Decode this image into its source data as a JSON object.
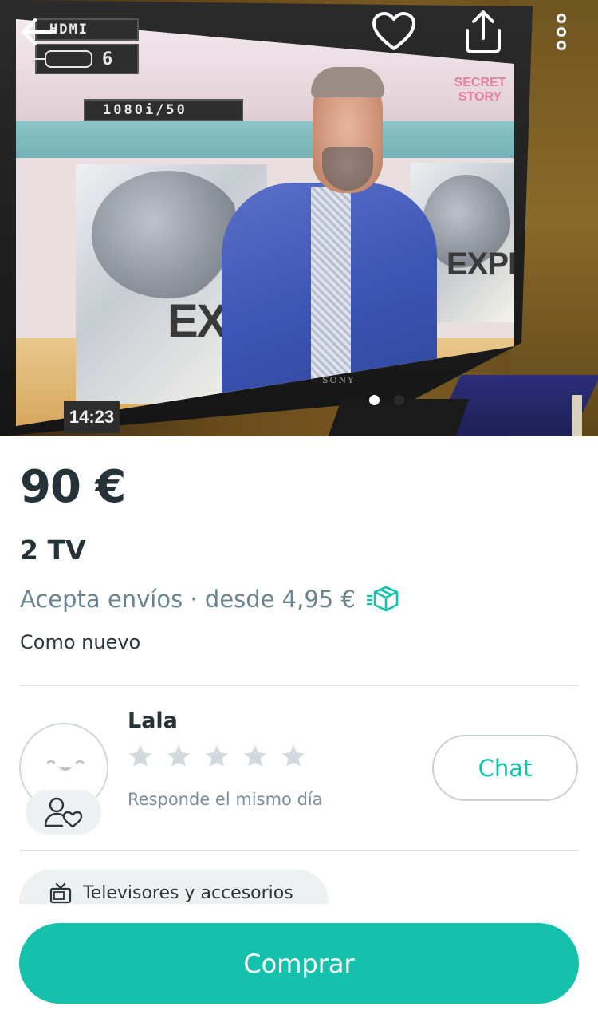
{
  "photo": {
    "osd_input_label": "HDMI",
    "osd_input_number": "6",
    "osd_resolution": "1080i/50",
    "clock": "14:23",
    "brand_on_tv": "SONY",
    "onscreen_left_text": "EX",
    "onscreen_right_text": "EXPR",
    "onscreen_logo": "SECRET STORY",
    "carousel_total": 2,
    "carousel_active": 1
  },
  "toolbar": {
    "back_icon": "arrow-left-icon",
    "favorite_icon": "heart-icon",
    "share_icon": "share-icon",
    "more_icon": "more-vertical-icon"
  },
  "product": {
    "price": "90 €",
    "title": "2 TV",
    "shipping": "Acepta envíos · desde 4,95 €",
    "shipping_icon": "box-shipping-icon",
    "condition": "Como nuevo"
  },
  "seller": {
    "name": "Lala",
    "rating_stars": 0,
    "rating_max": 5,
    "response": "Responde el mismo día",
    "chat_label": "Chat"
  },
  "category": {
    "icon": "tv-icon",
    "label": "Televisores y accesorios"
  },
  "actions": {
    "buy_label": "Comprar"
  },
  "colors": {
    "accent": "#13c1ac",
    "text_primary": "#253238",
    "text_secondary": "#6a8591",
    "star_empty": "#d3d9dc"
  }
}
